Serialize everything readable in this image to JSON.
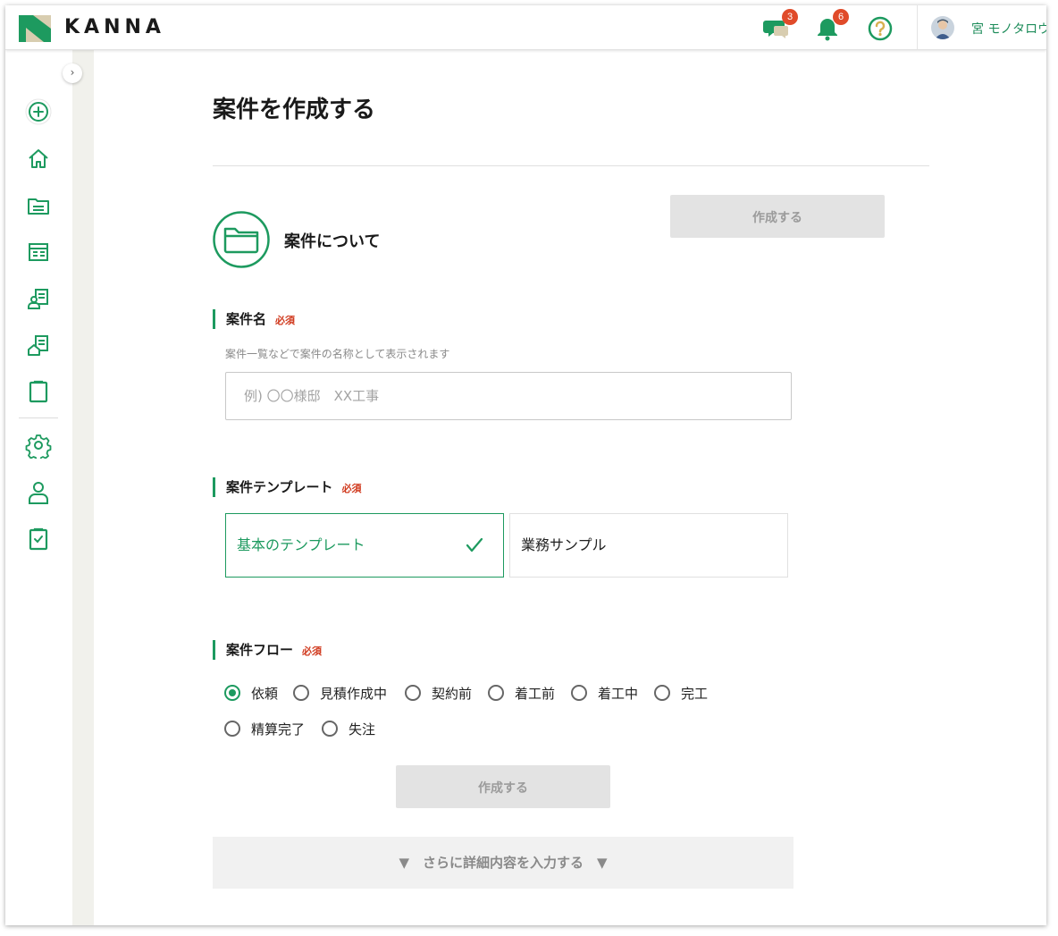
{
  "header": {
    "logo_text": "KANNA",
    "chat_badge": "3",
    "notification_badge": "6",
    "user_name": "宮 モノタロウ"
  },
  "sidebar": {
    "collapse_label": "›",
    "items": [
      {
        "icon": "add-circle-icon"
      },
      {
        "icon": "home-icon"
      },
      {
        "icon": "folder-icon"
      },
      {
        "icon": "document-list-icon"
      },
      {
        "icon": "person-document-icon"
      },
      {
        "icon": "house-document-icon"
      },
      {
        "icon": "clipboard-icon"
      },
      {
        "icon": "gear-icon"
      },
      {
        "icon": "user-icon"
      },
      {
        "icon": "clipboard-check-icon"
      }
    ]
  },
  "main": {
    "page_title": "案件を作成する",
    "create_button_label": "作成する",
    "section_title": "案件について",
    "project_name": {
      "label": "案件名",
      "required": "必須",
      "help": "案件一覧などで案件の名称として表示されます",
      "placeholder": "例) 〇〇様邸　XX工事",
      "value": ""
    },
    "template": {
      "label": "案件テンプレート",
      "required": "必須",
      "options": [
        "基本のテンプレート",
        "業務サンプル"
      ],
      "selected": "基本のテンプレート"
    },
    "flow": {
      "label": "案件フロー",
      "required": "必須",
      "options": [
        "依頼",
        "見積作成中",
        "契約前",
        "着工前",
        "着工中",
        "完工",
        "精算完了",
        "失注"
      ],
      "selected": "依頼"
    },
    "bottom_button_label": "作成する",
    "expand_label": "▼　さらに詳細内容を入力する　▼"
  },
  "colors": {
    "accent": "#1d9a5f",
    "required": "#d0391d",
    "badge": "#e04b2a",
    "disabled_button": "#e3e3e3",
    "sidebar_strip": "#f1f1ec"
  }
}
